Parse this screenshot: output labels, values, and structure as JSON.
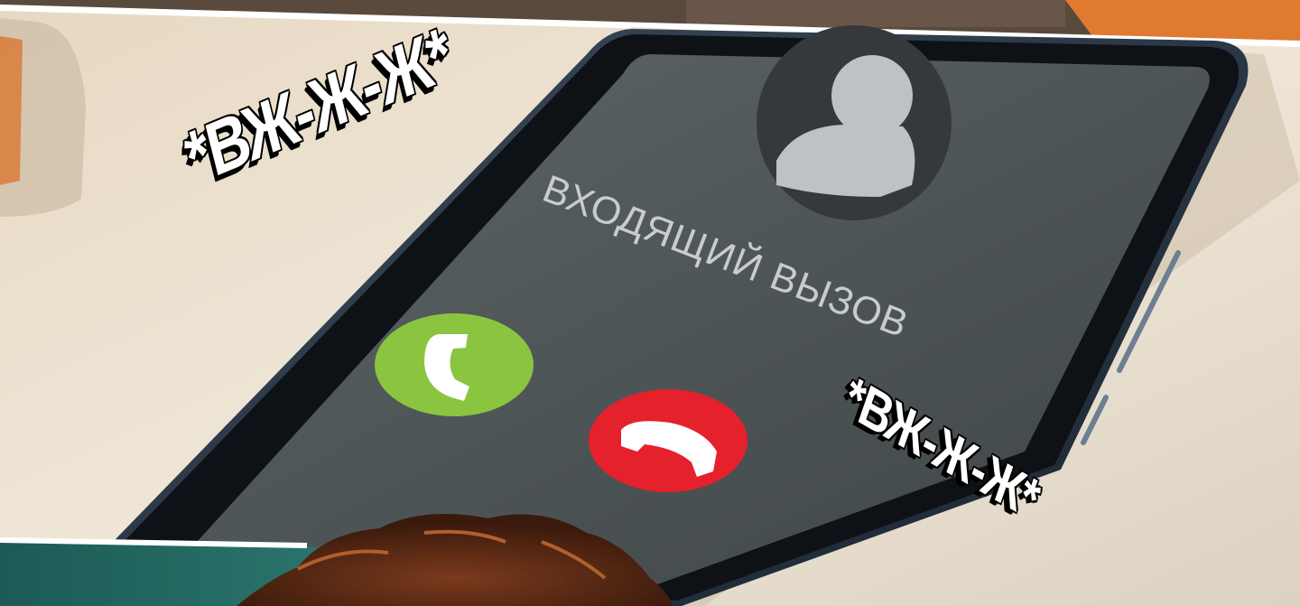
{
  "sound_effect_top": "*ВЖ-Ж-Ж*",
  "sound_effect_bottom": "*ВЖ-Ж-Ж*",
  "phone": {
    "call_status": "ВХОДЯЩИЙ ВЫЗОВ",
    "accept_button_icon": "phone-handset-icon",
    "decline_button_icon": "phone-hangup-icon",
    "caller_avatar_icon": "person-silhouette-icon"
  },
  "colors": {
    "accept": "#8bc53f",
    "decline": "#e5212b",
    "screen": "#4f5658",
    "table": "#e8ddcd"
  }
}
